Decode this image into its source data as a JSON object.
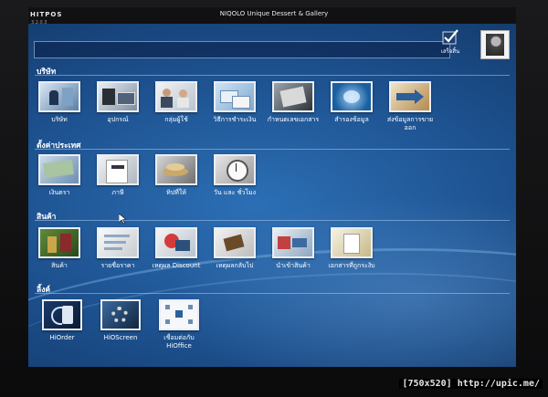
{
  "app": {
    "logo": "HITPOS",
    "version": "3.2.0.3",
    "title": "NIQOLO  Unique Dessert & Gallery"
  },
  "header": {
    "done_label": "เสร็จสิ้น",
    "avatar_icon": "user-photo-icon"
  },
  "sections": [
    {
      "title": "บริษัท",
      "items": [
        {
          "label": "บริษัท",
          "icon": "company-icon"
        },
        {
          "label": "อุปกรณ์",
          "icon": "devices-icon"
        },
        {
          "label": "กลุ่มผู้ใช้",
          "icon": "user-group-icon"
        },
        {
          "label": "วิธีการชำระเงิน",
          "icon": "payment-method-icon"
        },
        {
          "label": "กำหนดเลขเอกสาร",
          "icon": "document-number-icon"
        },
        {
          "label": "สำรองข้อมูล",
          "icon": "backup-icon"
        },
        {
          "label": "ส่งข้อมูลการขายออก",
          "icon": "export-sales-icon"
        }
      ]
    },
    {
      "title": "ตั้งค่าประเทศ",
      "items": [
        {
          "label": "เงินตรา",
          "icon": "currency-icon"
        },
        {
          "label": "ภาษี",
          "icon": "tax-icon"
        },
        {
          "label": "ทิปที่ให้",
          "icon": "tip-icon"
        },
        {
          "label": "วัน และ ชั่วโมง",
          "icon": "date-time-icon"
        }
      ]
    },
    {
      "title": "สินค้า",
      "items": [
        {
          "label": "สินค้า",
          "icon": "product-icon"
        },
        {
          "label": "รายชื่อราคา",
          "icon": "price-list-icon"
        },
        {
          "label": "เหตุผล Discount",
          "icon": "discount-reason-icon"
        },
        {
          "label": "เหตุผลกลับไป",
          "icon": "return-reason-icon"
        },
        {
          "label": "นำเข้าสินค้า",
          "icon": "import-product-icon"
        },
        {
          "label": "เอกสารที่ถูกระงับ",
          "icon": "suspended-document-icon"
        }
      ]
    },
    {
      "title": "ลิ้งค์",
      "items": [
        {
          "label": "HiOrder",
          "icon": "hiorder-icon"
        },
        {
          "label": "HiOScreen",
          "icon": "hioscreen-icon"
        },
        {
          "label": "เชื่อมต่อกับ HiOffice",
          "icon": "hioffice-icon"
        }
      ]
    }
  ],
  "watermark": "[750x520] http://upic.me/"
}
